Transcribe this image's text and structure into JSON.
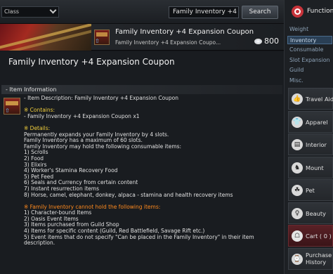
{
  "search": {
    "class_value": "Class",
    "query": "Family Inventory +4",
    "button": "Search"
  },
  "banner": {
    "title": "Family Inventory +4 Expansion Coupon",
    "subtitle": "Family Inventory +4 Expansion Coupo...",
    "price": "800"
  },
  "detail": {
    "title": "Family Inventory +4 Expansion Coupon",
    "section_header": "- Item Information",
    "lines": [
      {
        "t": "- Item Description: Family Inventory +4 Expansion Coupon",
        "c": ""
      },
      {
        "t": "",
        "c": "gap"
      },
      {
        "t": "※ Contains:",
        "c": "yl"
      },
      {
        "t": "- Family Inventory +4 Expansion Coupon x1",
        "c": ""
      },
      {
        "t": "",
        "c": "gap"
      },
      {
        "t": "※ Details:",
        "c": "yl"
      },
      {
        "t": "Permanently expands your Family Inventory by 4 slots.",
        "c": ""
      },
      {
        "t": "Family Inventory has a maximum of 60 slots.",
        "c": ""
      },
      {
        "t": "Family Inventory may hold the following consumable items:",
        "c": ""
      },
      {
        "t": "1) Scrolls",
        "c": ""
      },
      {
        "t": "2) Food",
        "c": ""
      },
      {
        "t": "3) Elixirs",
        "c": ""
      },
      {
        "t": "4) Worker's Stamina Recovery Food",
        "c": ""
      },
      {
        "t": "5) Pet Feed",
        "c": ""
      },
      {
        "t": "6) Seals and Currency from certain content",
        "c": ""
      },
      {
        "t": "7) Instant resurrection items",
        "c": ""
      },
      {
        "t": "8) Horse, camel, elephant, donkey, alpaca - stamina and health recovery items",
        "c": ""
      },
      {
        "t": "",
        "c": "gap"
      },
      {
        "t": "※ Family Inventory cannot hold the following items:",
        "c": "or"
      },
      {
        "t": "1) Character-bound Items",
        "c": ""
      },
      {
        "t": "2) Oasis Event Items",
        "c": ""
      },
      {
        "t": "3) Items purchased from Guild Shop",
        "c": ""
      },
      {
        "t": "4) Items for specific content (Guild, Red Battlefield, Savage Rift etc.)",
        "c": ""
      },
      {
        "t": "5) Event items that do not specify \"Can be placed in the Family Inventory\" in their item",
        "c": ""
      },
      {
        "t": "description.",
        "c": ""
      }
    ]
  },
  "sidebar": {
    "function_label": "Function",
    "categories": [
      "Weight",
      "Inventory",
      "Consumable",
      "Slot Expansion",
      "Guild",
      "Misc."
    ],
    "active_category": "Inventory",
    "buttons": [
      {
        "name": "travel-aid",
        "label": "Travel Aid",
        "icon": "thumbs-up-icon",
        "glyph": "👍"
      },
      {
        "name": "apparel",
        "label": "Apparel",
        "icon": "shirt-icon",
        "glyph": "👕"
      },
      {
        "name": "interior",
        "label": "Interior",
        "icon": "cabinet-icon",
        "glyph": "▤"
      },
      {
        "name": "mount",
        "label": "Mount",
        "icon": "horse-icon",
        "glyph": "♞"
      },
      {
        "name": "pet",
        "label": "Pet",
        "icon": "paw-icon",
        "glyph": "☘"
      },
      {
        "name": "beauty",
        "label": "Beauty",
        "icon": "dress-icon",
        "glyph": "♀"
      },
      {
        "name": "cart",
        "label": "Cart ( 0 )",
        "icon": "cart-icon",
        "glyph": "☖"
      },
      {
        "name": "purchase-history",
        "label": "Purchase\nHistory",
        "icon": "history-icon",
        "glyph": "⌚"
      }
    ]
  }
}
